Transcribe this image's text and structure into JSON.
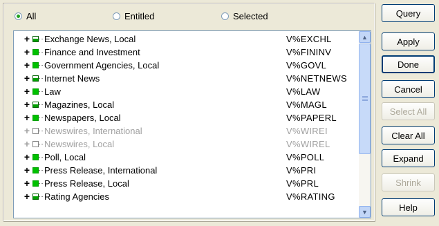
{
  "filters": {
    "all": "All",
    "entitled": "Entitled",
    "selected": "Selected",
    "checked": "all"
  },
  "list": {
    "items": [
      {
        "name": "Exchange News, Local",
        "code": "V%EXCHL",
        "state": "partial",
        "enabled": true
      },
      {
        "name": "Finance and Investment",
        "code": "V%FININV",
        "state": "full",
        "enabled": true
      },
      {
        "name": "Government Agencies, Local",
        "code": "V%GOVL",
        "state": "full",
        "enabled": true
      },
      {
        "name": "Internet News",
        "code": "V%NETNEWS",
        "state": "partial",
        "enabled": true
      },
      {
        "name": "Law",
        "code": "V%LAW",
        "state": "full",
        "enabled": true
      },
      {
        "name": "Magazines, Local",
        "code": "V%MAGL",
        "state": "partial",
        "enabled": true
      },
      {
        "name": "Newspapers, Local",
        "code": "V%PAPERL",
        "state": "full",
        "enabled": true
      },
      {
        "name": "Newswires, International",
        "code": "V%WIREI",
        "state": "empty",
        "enabled": false
      },
      {
        "name": "Newswires, Local",
        "code": "V%WIREL",
        "state": "empty",
        "enabled": false
      },
      {
        "name": "Poll, Local",
        "code": "V%POLL",
        "state": "full",
        "enabled": true
      },
      {
        "name": "Press Release, International",
        "code": "V%PRI",
        "state": "full",
        "enabled": true
      },
      {
        "name": "Press Release, Local",
        "code": "V%PRL",
        "state": "full",
        "enabled": true
      },
      {
        "name": "Rating Agencies",
        "code": "V%RATING",
        "state": "partial",
        "enabled": true
      }
    ],
    "expand_glyph": "+"
  },
  "buttons": {
    "query": "Query",
    "apply": "Apply",
    "done": "Done",
    "cancel": "Cancel",
    "select_all": "Select All",
    "clear_all": "Clear All",
    "expand": "Expand",
    "shrink": "Shrink",
    "help": "Help"
  }
}
